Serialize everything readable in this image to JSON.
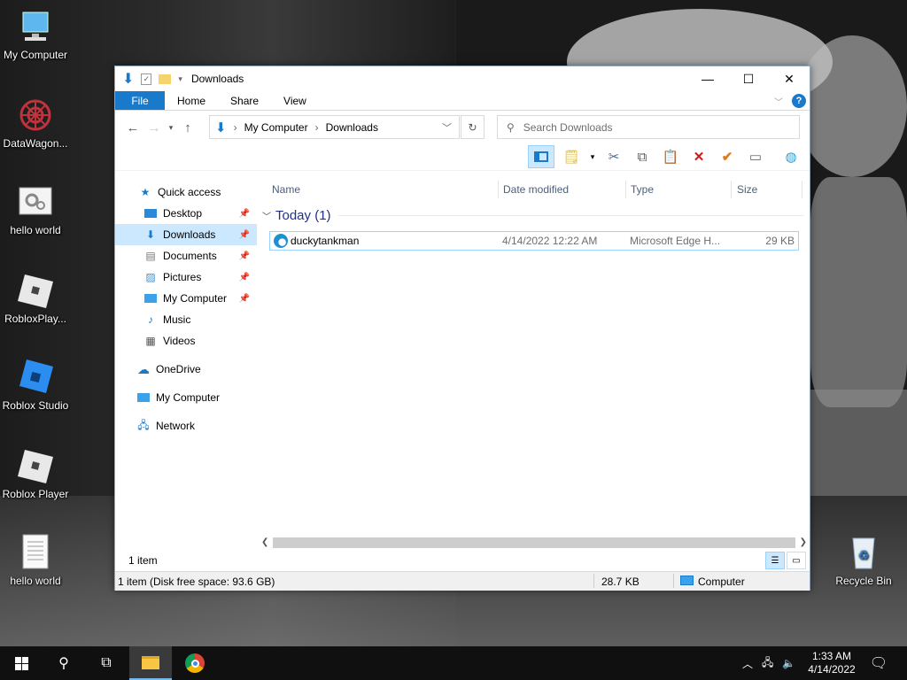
{
  "desktop_icons": [
    {
      "label": "My Computer"
    },
    {
      "label": "DataWagon..."
    },
    {
      "label": "hello world"
    },
    {
      "label": "RobloxPlay..."
    },
    {
      "label": "Roblox Studio"
    },
    {
      "label": "Roblox Player"
    },
    {
      "label": "hello world"
    },
    {
      "label": "Recycle Bin"
    }
  ],
  "window": {
    "title": "Downloads",
    "ribbon": {
      "file": "File",
      "tabs": [
        "Home",
        "Share",
        "View"
      ],
      "help": "?"
    },
    "address": {
      "segments": [
        "My Computer",
        "Downloads"
      ]
    },
    "search_placeholder": "Search Downloads",
    "nav": [
      {
        "label": "Quick access"
      },
      {
        "label": "Desktop"
      },
      {
        "label": "Downloads"
      },
      {
        "label": "Documents"
      },
      {
        "label": "Pictures"
      },
      {
        "label": "My Computer"
      },
      {
        "label": "Music"
      },
      {
        "label": "Videos"
      },
      {
        "label": "OneDrive"
      },
      {
        "label": "My Computer"
      },
      {
        "label": "Network"
      }
    ],
    "columns": [
      "Name",
      "Date modified",
      "Type",
      "Size"
    ],
    "group": "Today (1)",
    "files": [
      {
        "name": "duckytankman",
        "date": "4/14/2022 12:22 AM",
        "type": "Microsoft Edge H...",
        "size": "29 KB"
      }
    ],
    "item_count": "1 item",
    "status": {
      "left": "1 item (Disk free space: 93.6 GB)",
      "size": "28.7 KB",
      "location": "Computer"
    }
  },
  "taskbar": {
    "time": "1:33 AM",
    "date": "4/14/2022"
  },
  "colors": {
    "accent": "#1979ca",
    "selection": "#cce8ff"
  }
}
